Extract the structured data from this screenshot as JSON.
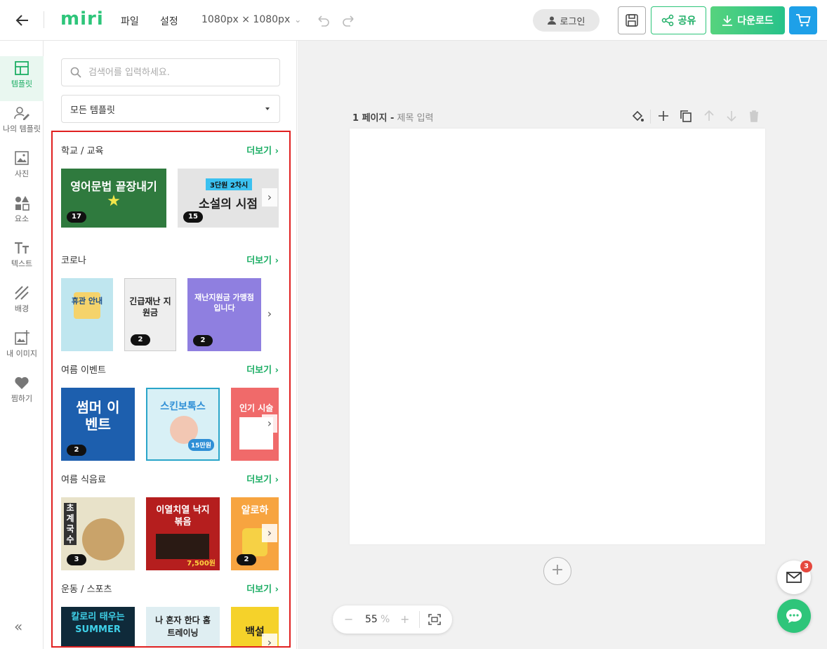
{
  "header": {
    "logo": "miri",
    "menu_file": "파일",
    "menu_settings": "설정",
    "canvas_size": "1080px × 1080px",
    "login": "로그인",
    "share": "공유",
    "download": "다운로드"
  },
  "sidebar": {
    "items": [
      {
        "label": "템플릿",
        "icon": "template-icon"
      },
      {
        "label": "나의 템플릿",
        "icon": "my-template-icon"
      },
      {
        "label": "사진",
        "icon": "photo-icon"
      },
      {
        "label": "요소",
        "icon": "elements-icon"
      },
      {
        "label": "텍스트",
        "icon": "text-icon"
      },
      {
        "label": "배경",
        "icon": "background-icon"
      },
      {
        "label": "내 이미지",
        "icon": "my-image-icon"
      },
      {
        "label": "찜하기",
        "icon": "heart-icon"
      }
    ],
    "collapse": "«"
  },
  "panel": {
    "search_placeholder": "검색어를 입력하세요.",
    "filter_value": "모든 템플릿",
    "categories": [
      {
        "name": "학교 / 교육",
        "more": "더보기",
        "thumbs": [
          {
            "title": "영어문법 끝장내기",
            "count": "17"
          },
          {
            "title": "소설의 시점",
            "subtitle": "3단원 2차시",
            "count": "15"
          }
        ]
      },
      {
        "name": "코로나",
        "more": "더보기",
        "thumbs": [
          {
            "title": "휴관 안내"
          },
          {
            "title": "긴급재난 지원금",
            "count": "2"
          },
          {
            "title": "재난지원금 가맹점입니다",
            "count": "2"
          }
        ]
      },
      {
        "name": "여름 이벤트",
        "more": "더보기",
        "thumbs": [
          {
            "title": "썸머 이벤트",
            "count": "2"
          },
          {
            "title": "스킨보톡스",
            "badge": "15만원"
          },
          {
            "title": "인기 시술"
          }
        ]
      },
      {
        "name": "여름 식음료",
        "more": "더보기",
        "thumbs": [
          {
            "title": "초계국수",
            "count": "3"
          },
          {
            "title": "이열치열 낙지볶음",
            "price": "7,500원"
          },
          {
            "title": "알로하",
            "count": "2"
          }
        ]
      },
      {
        "name": "운동 / 스포츠",
        "more": "더보기",
        "thumbs": [
          {
            "title": "칼로리 태우는 SUMMER"
          },
          {
            "title": "나 혼자 한다 홈트레이닝"
          },
          {
            "title": "백설"
          }
        ]
      }
    ]
  },
  "canvas": {
    "page_label": "1 페이지 -",
    "page_title_placeholder": "제목 입력",
    "zoom_value": "55",
    "zoom_unit": "%",
    "add_page": "+"
  },
  "floating": {
    "mail_badge": "3"
  },
  "colors": {
    "brand": "#2ec57a",
    "selection_border": "#e02020",
    "cart": "#1ea0e8"
  }
}
